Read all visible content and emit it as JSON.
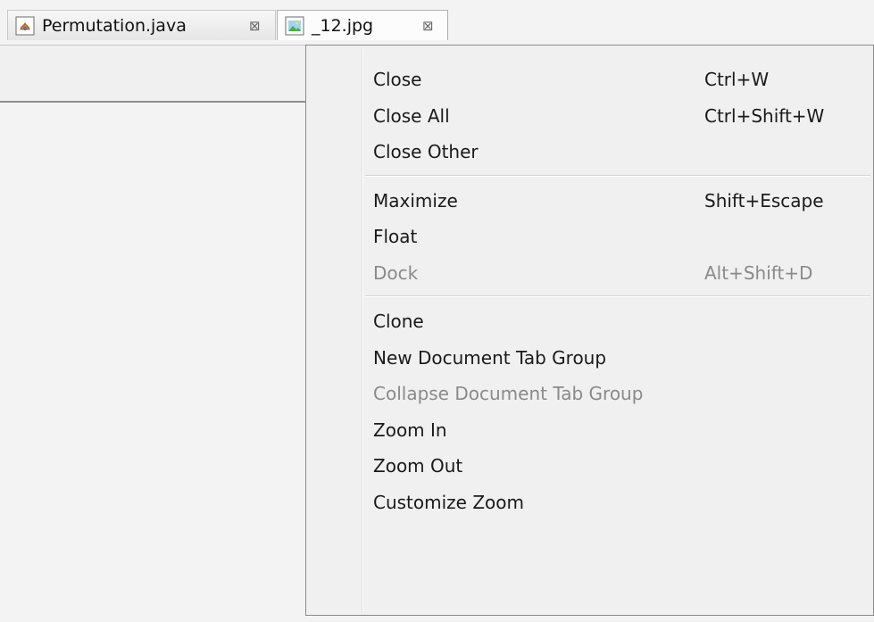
{
  "tabs": [
    {
      "label": "Permutation.java",
      "icon": "java-file-icon",
      "close": "⊠"
    },
    {
      "label": "_12.jpg",
      "icon": "image-file-icon",
      "close": "⊠"
    }
  ],
  "menu": {
    "groups": [
      [
        {
          "label": "Close",
          "accel": "Ctrl+W",
          "enabled": true
        },
        {
          "label": "Close All",
          "accel": "Ctrl+Shift+W",
          "enabled": true
        },
        {
          "label": "Close Other",
          "accel": "",
          "enabled": true
        }
      ],
      [
        {
          "label": "Maximize",
          "accel": "Shift+Escape",
          "enabled": true
        },
        {
          "label": "Float",
          "accel": "",
          "enabled": true
        },
        {
          "label": "Dock",
          "accel": "Alt+Shift+D",
          "enabled": false
        }
      ],
      [
        {
          "label": "Clone",
          "accel": "",
          "enabled": true
        },
        {
          "label": "New Document Tab Group",
          "accel": "",
          "enabled": true
        },
        {
          "label": "Collapse Document Tab Group",
          "accel": "",
          "enabled": false
        },
        {
          "label": "Zoom In",
          "accel": "",
          "enabled": true
        },
        {
          "label": "Zoom Out",
          "accel": "",
          "enabled": true
        },
        {
          "label": "Customize Zoom",
          "accel": "",
          "enabled": true
        }
      ]
    ]
  },
  "colors": {
    "disabled": "#8a8a8a",
    "text": "#1a1a1a"
  }
}
